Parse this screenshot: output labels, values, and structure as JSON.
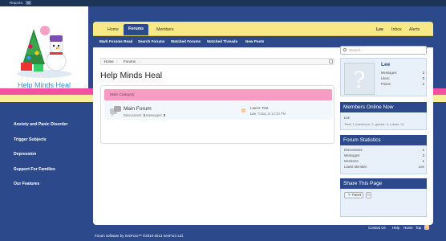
{
  "modbar": {
    "reports_label": "Reports:",
    "reports_count": "0"
  },
  "site": {
    "brand": "Help Minds Heal"
  },
  "leftnav": [
    {
      "label": "Anxiety and Panic Disorder"
    },
    {
      "label": "Trigger Subjects"
    },
    {
      "label": "Depression"
    },
    {
      "label": "Support For Families"
    },
    {
      "label": "Our Features"
    }
  ],
  "tabs": {
    "home": "Home",
    "forums": "Forums",
    "members": "Members",
    "user": "Lee",
    "inbox": "Inbox",
    "alerts": "Alerts"
  },
  "subnav": [
    {
      "label": "Mark Forums Read"
    },
    {
      "label": "Search Forums"
    },
    {
      "label": "Watched Forums"
    },
    {
      "label": "Watched Threads"
    },
    {
      "label": "New Posts"
    }
  ],
  "breadcrumb": {
    "home": "Home",
    "forums": "Forums"
  },
  "page_title": "Help Minds Heal",
  "category": {
    "title": "Main Category"
  },
  "forum": {
    "name": "Main Forum",
    "discussions_label": "Discussions:",
    "discussions": "1",
    "messages_label": "Messages:",
    "messages": "3",
    "latest_label": "Latest:",
    "latest_title": "Test",
    "latest_user": "Lee",
    "latest_time": ", Today at 12:29 PM"
  },
  "search": {
    "placeholder": "Search..."
  },
  "userbox": {
    "name": "Lee",
    "messages_label": "Messages:",
    "messages": "3",
    "likes_label": "Likes:",
    "likes": "0",
    "points_label": "Points:",
    "points": "1"
  },
  "online": {
    "title": "Members Online Now",
    "member": "Lee",
    "summary": "Total: 1 (members: 1, guests: 0, robots: 0)"
  },
  "stats": {
    "title": "Forum Statistics",
    "rows": [
      {
        "label": "Discussions:",
        "value": "1"
      },
      {
        "label": "Messages:",
        "value": "3"
      },
      {
        "label": "Members:",
        "value": "1"
      },
      {
        "label": "Latest Member:",
        "value": "Lee"
      }
    ]
  },
  "share": {
    "title": "Share This Page",
    "tweet": "Tweet",
    "count": "0"
  },
  "footer": {
    "contact": "Contact Us",
    "help": "Help",
    "home": "Home",
    "top": "Top",
    "copyright": "Forum software by XenForo™ ©2010-2013 XenForo Ltd."
  },
  "colors": {
    "nav_blue": "#2c4a8b",
    "tab_yellow": "#f7ea86",
    "category_pink": "#f99cc3",
    "stripe_pink": "#f34fa3"
  },
  "icons": [
    "search-icon",
    "rss-icon",
    "forum-icon",
    "avatar-placeholder-icon",
    "twitter-bird-icon",
    "jump-menu-icon"
  ]
}
